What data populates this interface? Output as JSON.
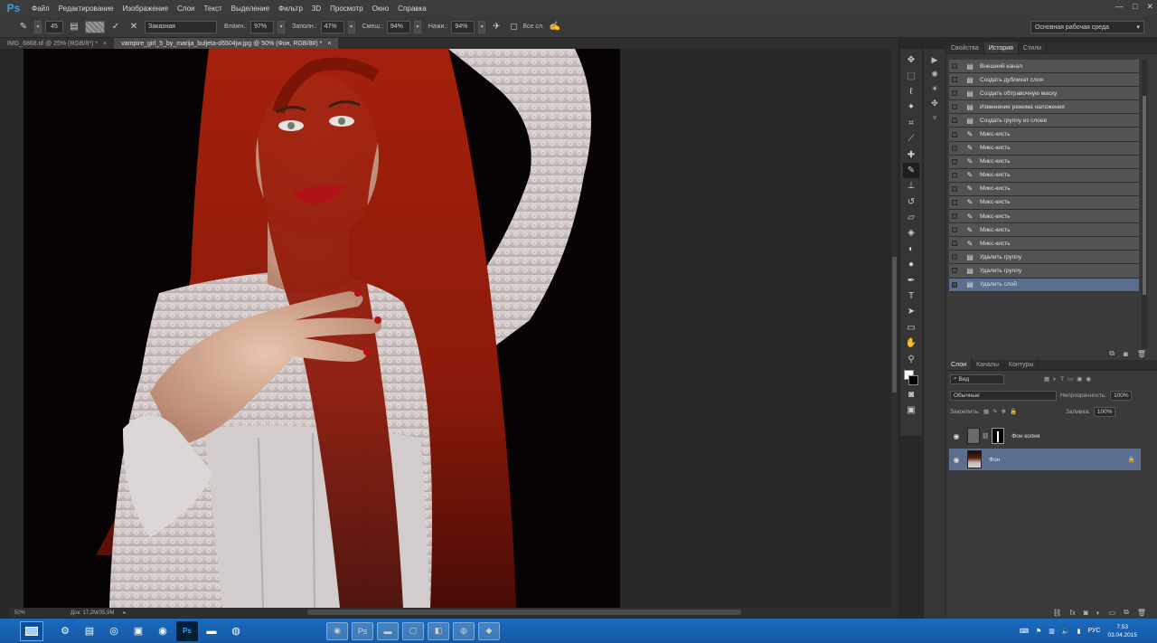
{
  "app": {
    "logo": "Ps"
  },
  "menu": [
    "Файл",
    "Редактирование",
    "Изображение",
    "Слои",
    "Текст",
    "Выделение",
    "Фильтр",
    "3D",
    "Просмотр",
    "Окно",
    "Справка"
  ],
  "options": {
    "brush_size": "45",
    "mode": "Заказная",
    "wetness_label": "Влажн.:",
    "wetness": "97%",
    "load_label": "Заполн.:",
    "load": "47%",
    "mix_label": "Смеш.:",
    "mix": "94%",
    "flow_label": "Нажи.:",
    "flow": "94%",
    "all_layers_label": "Все сл.",
    "workspace": "Основная рабочая среда"
  },
  "doc_tabs": [
    {
      "label": "IMG_6868.tif @ 25% (RGB/8*) *"
    },
    {
      "label": "vampire_girl_5_by_marija_buljeta-d6504jw.jpg @ 50% (Фон, RGB/8#) *"
    }
  ],
  "status": {
    "zoom": "50%",
    "doc": "Док: 17,2M/35,9M"
  },
  "right_panel": {
    "tabs": [
      "Свойства",
      "История",
      "Стили"
    ],
    "active_tab": "История",
    "history": [
      "Внешний канал",
      "Создать дубликат слоя",
      "Создать обтравочную маску",
      "Изменение режима наложения",
      "Создать группу из слоев",
      "Микс-кисть",
      "Микс-кисть",
      "Микс-кисть",
      "Микс-кисть",
      "Микс-кисть",
      "Микс-кисть",
      "Микс-кисть",
      "Микс-кисть",
      "Микс-кисть",
      "Удалить группу",
      "Удалить группу",
      "Удалить слой"
    ]
  },
  "layers_panel": {
    "tabs": [
      "Слои",
      "Каналы",
      "Контуры"
    ],
    "filter": "Вид",
    "blend_mode": "Обычные",
    "opacity_label": "Непрозрачность:",
    "opacity": "100%",
    "lock_label": "Закрепить:",
    "fill_label": "Заливка:",
    "fill": "100%",
    "layers": [
      {
        "name": "Фон копия"
      },
      {
        "name": "Фон"
      }
    ]
  },
  "taskbar": {
    "clock_time": "7:53",
    "clock_date": "03.04.2015",
    "lang": "РУС"
  },
  "colors": {
    "accent": "#2fa3e8",
    "selection": "#5a6f8f",
    "layer_selected": "#5a6f8f"
  }
}
